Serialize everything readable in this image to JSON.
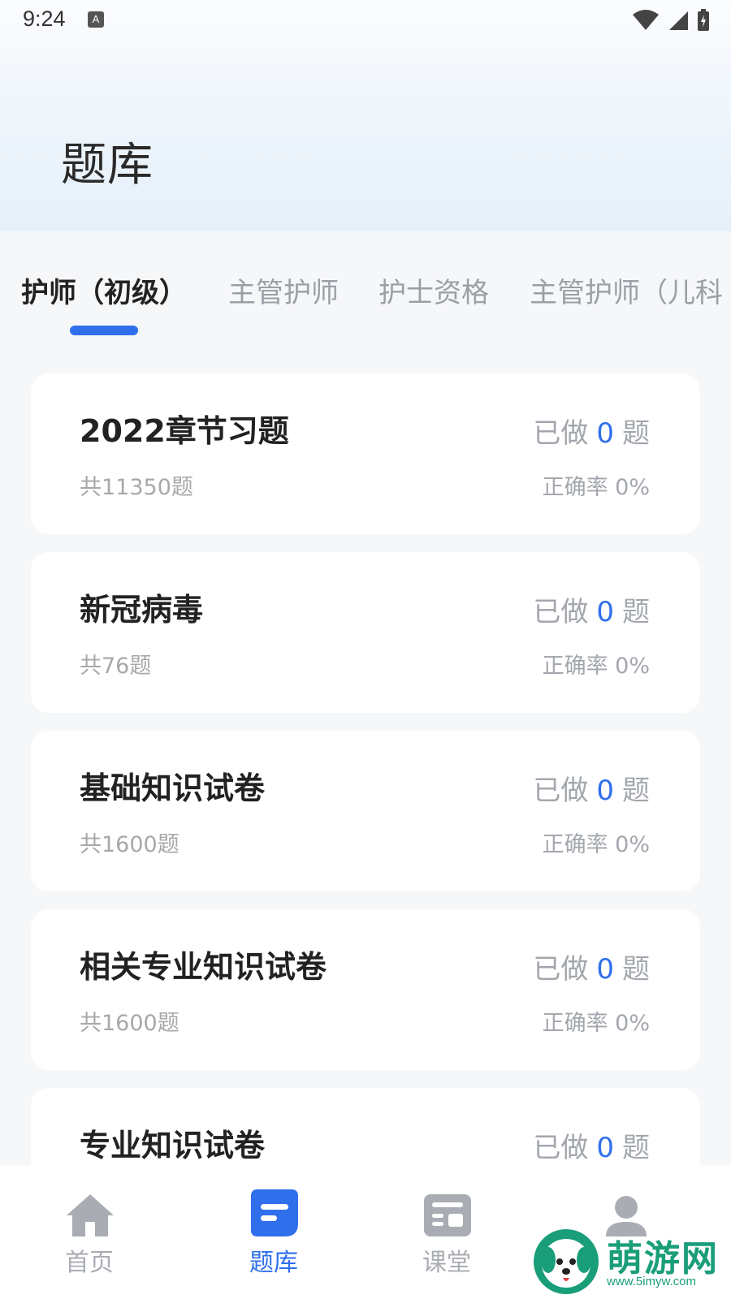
{
  "status_bar": {
    "time": "9:24",
    "notification_icon_letter": "A",
    "icons": [
      "wifi-icon",
      "signal-icon",
      "battery-icon"
    ]
  },
  "header": {
    "title": "题库"
  },
  "tabs": [
    {
      "label": "护师（初级）",
      "active": true
    },
    {
      "label": "主管护师",
      "active": false
    },
    {
      "label": "护士资格",
      "active": false
    },
    {
      "label": "主管护师（儿科",
      "active": false
    }
  ],
  "cards": [
    {
      "title": "2022章节习题",
      "total": "共11350题",
      "done_prefix": "已做",
      "done_count": "0",
      "done_suffix": "题",
      "accuracy": "正确率 0%"
    },
    {
      "title": "新冠病毒",
      "total": "共76题",
      "done_prefix": "已做",
      "done_count": "0",
      "done_suffix": "题",
      "accuracy": "正确率 0%"
    },
    {
      "title": "基础知识试卷",
      "total": "共1600题",
      "done_prefix": "已做",
      "done_count": "0",
      "done_suffix": "题",
      "accuracy": "正确率 0%"
    },
    {
      "title": "相关专业知识试卷",
      "total": "共1600题",
      "done_prefix": "已做",
      "done_count": "0",
      "done_suffix": "题",
      "accuracy": "正确率 0%"
    },
    {
      "title": "专业知识试卷",
      "total": "",
      "done_prefix": "已做",
      "done_count": "0",
      "done_suffix": "题",
      "accuracy": ""
    }
  ],
  "bottom_nav": [
    {
      "label": "首页",
      "icon": "home-icon",
      "active": false
    },
    {
      "label": "题库",
      "icon": "question-bank-icon",
      "active": true
    },
    {
      "label": "课堂",
      "icon": "classroom-icon",
      "active": false
    },
    {
      "label": "",
      "icon": "profile-icon",
      "active": false
    }
  ],
  "watermark": {
    "text": "萌游网",
    "url": "www.5imyw.com"
  },
  "colors": {
    "accent": "#2f6fec",
    "inactive": "#a9adb3",
    "watermark": "#1a9e7a"
  }
}
